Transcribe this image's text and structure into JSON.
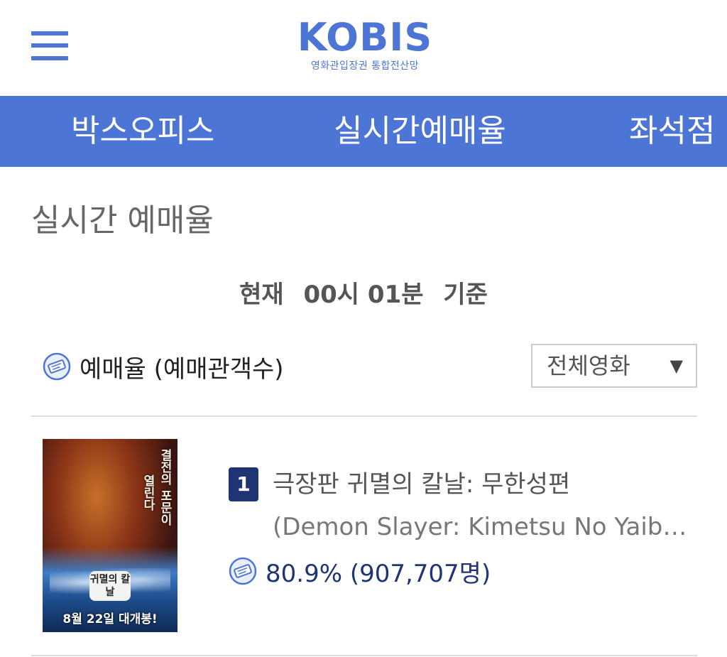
{
  "header": {
    "logo": "KOBIS",
    "logo_subtitle": "영화관입장권 통합전산망"
  },
  "nav": {
    "items": [
      {
        "label": "박스오피스"
      },
      {
        "label": "실시간예매율"
      },
      {
        "label": "좌석점"
      }
    ]
  },
  "page": {
    "title": "실시간 예매율"
  },
  "status": {
    "prefix": "현재",
    "time": "00시 01분",
    "suffix": "기준"
  },
  "rate": {
    "label": "예매율 (예매관객수)"
  },
  "filter": {
    "selected": "전체영화"
  },
  "movies": [
    {
      "rank": "1",
      "title": "극장판 귀멸의 칼날: 무한성편",
      "original_title": "(Demon Slayer: Kimetsu No Yaiba...",
      "rate_text": "80.9% (907,707명)",
      "poster": {
        "tagline_1": "결전의 포문이",
        "tagline_2": "열린다",
        "logo": "귀멸의 칼날",
        "release": "8월 22일 대개봉!"
      }
    }
  ],
  "colors": {
    "brand": "#4d75d6",
    "rank_badge": "#1f3573"
  }
}
